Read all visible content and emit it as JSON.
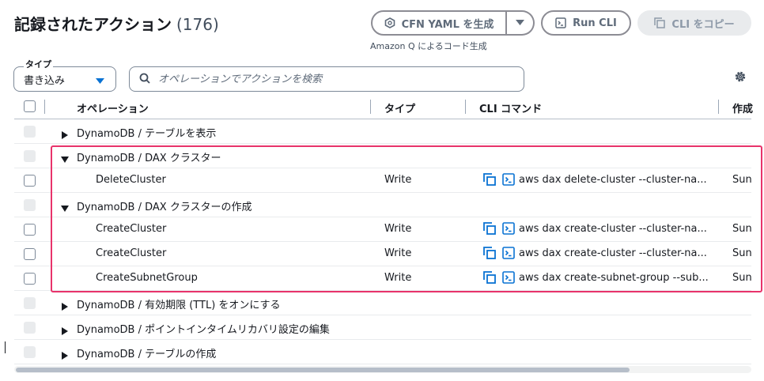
{
  "header": {
    "title": "記録されたアクション",
    "count": "(176)",
    "cfn_button_label": "CFN YAML を生成",
    "run_cli_label": "Run CLI",
    "copy_cli_label": "CLI をコピー",
    "subnote": "Amazon Q によるコード生成"
  },
  "filter": {
    "type_label": "タイプ",
    "type_value": "書き込み",
    "search_placeholder": "オペレーションでアクションを検索"
  },
  "table": {
    "columns": {
      "operation": "オペレーション",
      "type": "タイプ",
      "cli": "CLI コマンド",
      "created": "作成"
    },
    "rows": [
      {
        "kind": "group",
        "expanded": false,
        "label": "DynamoDB / テーブルを表示"
      },
      {
        "kind": "group",
        "expanded": true,
        "label": "DynamoDB / DAX クラスター"
      },
      {
        "kind": "item",
        "label": "DeleteCluster",
        "type": "Write",
        "cli": "aws dax delete-cluster --cluster-na...",
        "time": "Sun"
      },
      {
        "kind": "group",
        "expanded": true,
        "label": "DynamoDB / DAX クラスターの作成"
      },
      {
        "kind": "item",
        "label": "CreateCluster",
        "type": "Write",
        "cli": "aws dax create-cluster --cluster-na...",
        "time": "Sun"
      },
      {
        "kind": "item",
        "label": "CreateCluster",
        "type": "Write",
        "cli": "aws dax create-cluster --cluster-na...",
        "time": "Sun"
      },
      {
        "kind": "item",
        "label": "CreateSubnetGroup",
        "type": "Write",
        "cli": "aws dax create-subnet-group --sub...",
        "time": "Sun"
      },
      {
        "kind": "group",
        "expanded": false,
        "label": "DynamoDB / 有効期限 (TTL) をオンにする"
      },
      {
        "kind": "group",
        "expanded": false,
        "label": "DynamoDB / ポイントインタイムリカバリ設定の編集"
      },
      {
        "kind": "group",
        "expanded": false,
        "label": "DynamoDB / テーブルの作成"
      }
    ]
  },
  "colors": {
    "accent": "#0972d3",
    "highlight": "#e8336b",
    "text": "#16191f"
  },
  "icons": {
    "cfn": "cloudformation-icon",
    "caret": "caret-down-icon",
    "terminal": "terminal-icon",
    "copy": "copy-icon",
    "search": "search-icon",
    "settings": "gear-icon"
  }
}
